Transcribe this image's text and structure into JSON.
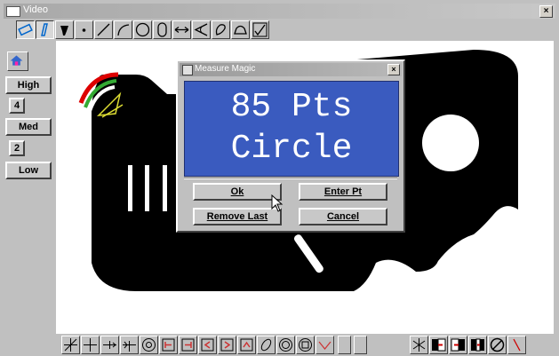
{
  "window": {
    "title": "Video",
    "close_glyph": "×"
  },
  "top_toolbar": {
    "tools": [
      "rectangle-select-icon",
      "pen-icon",
      "probe-icon",
      "point-icon",
      "line-icon",
      "arc-icon",
      "circle-icon",
      "slot-icon",
      "distance-icon",
      "angle-icon",
      "contour-icon",
      "hood-icon",
      "checkbox-icon"
    ]
  },
  "left_panel": {
    "buttons": {
      "high": "High",
      "med": "Med",
      "low": "Low"
    },
    "values": {
      "n4": "4",
      "n2": "2"
    }
  },
  "dialog": {
    "title": "Measure Magic",
    "close_glyph": "×",
    "display_line1": "85 Pts",
    "display_line2": "Circle",
    "buttons": {
      "ok": "Ok",
      "enter_pt": "Enter Pt",
      "remove_last": "Remove Last",
      "cancel": "Cancel"
    }
  },
  "bottom_toolbar": {
    "tools": [
      "star-icon",
      "crosshair-icon",
      "crosshair-arrow-icon",
      "crosshair-line-icon",
      "target-icon",
      "bracket-left-icon",
      "bracket-right-icon",
      "bracket-in-icon",
      "bracket-out-icon",
      "bracket-up-icon",
      "ellipse-icon",
      "ring-icon",
      "ring-square-icon",
      "chevron-down-icon",
      "separator-icon",
      "separator-icon",
      "asterisk-icon",
      "edge-left-icon",
      "edge-right-icon",
      "edge-both-icon",
      "no-icon",
      "slash-icon"
    ]
  },
  "colors": {
    "display_bg": "#3a5bbf",
    "part": "#000000"
  }
}
